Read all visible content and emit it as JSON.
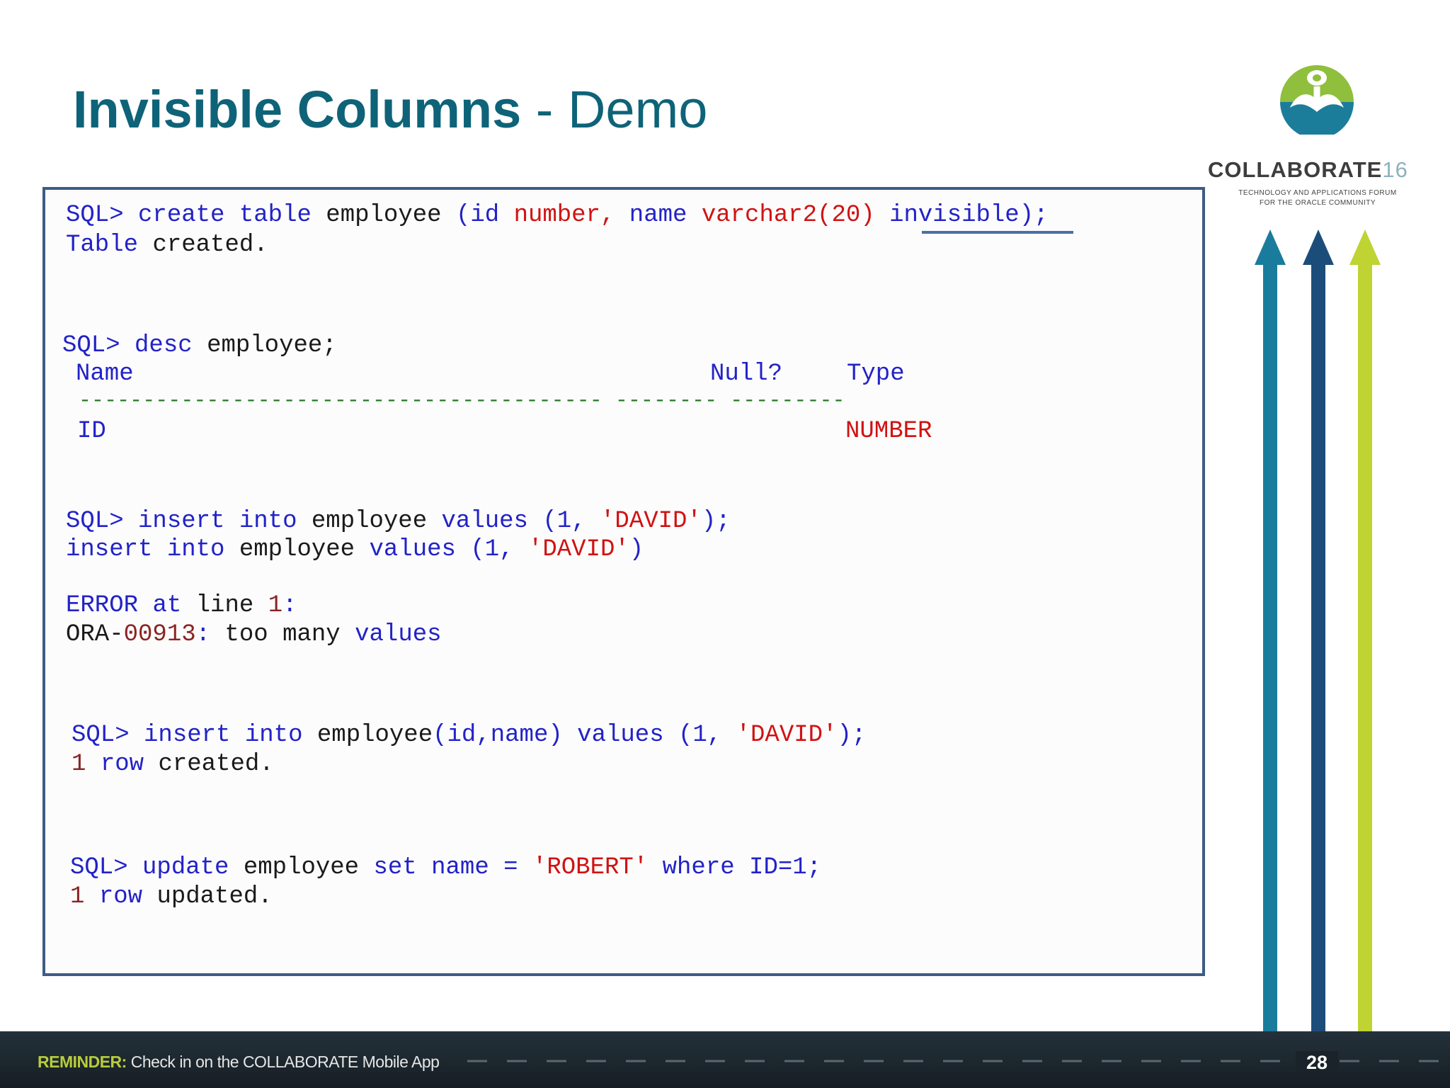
{
  "title": {
    "bold": "Invisible Columns",
    "rest": " - Demo"
  },
  "code": {
    "l1": {
      "p": "SQL>",
      "a": "create",
      "b": "table",
      "c": "employee",
      "d": "(id",
      "e": "number,",
      "f": "name",
      "g": "varchar2(20)",
      "h": "invisible);"
    },
    "l2": {
      "a": "Table",
      "b": "created."
    },
    "l3": {
      "p": "SQL>",
      "a": "desc",
      "b": "employee;"
    },
    "l4": {
      "name": "Name",
      "null": "Null?",
      "type": "Type"
    },
    "l5": {
      "d1": "-----------------------------------------",
      "d2": "--------",
      "d3": "---------"
    },
    "l6": {
      "id": "ID",
      "type": "NUMBER"
    },
    "l7": {
      "p": "SQL>",
      "a": "insert",
      "b": "into",
      "c": "employee",
      "d": "values",
      "e": "(1,",
      "f": "'DAVID'",
      "g": ");"
    },
    "l8": {
      "a": "insert",
      "b": "into",
      "c": "employee",
      "d": "values",
      "e": "(1,",
      "f": "'DAVID'",
      "g": ")"
    },
    "l9": {
      "a": "ERROR",
      "b": "at",
      "c": "line",
      "d": "1",
      "e": ":"
    },
    "l10": {
      "a": "ORA-",
      "b": "00913",
      "c": ":",
      "d": "too",
      "e": "many",
      "f": "values"
    },
    "l11": {
      "p": "SQL>",
      "a": "insert",
      "b": "into",
      "c": "employee",
      "d": "(id,name)",
      "e": "values",
      "f": "(1,",
      "g": "'DAVID'",
      "h": ");"
    },
    "l12": {
      "a": "1",
      "b": "row",
      "c": "created."
    },
    "l13": {
      "p": "SQL>",
      "a": "update",
      "b": "employee",
      "c": "set",
      "d": "name",
      "e": "=",
      "f": "'ROBERT'",
      "g": "where",
      "h": "ID=1;"
    },
    "l14": {
      "a": "1",
      "b": "row",
      "c": "updated."
    }
  },
  "logo": {
    "word": "COLLABORATE",
    "year": "16",
    "tag1": "TECHNOLOGY AND APPLICATIONS FORUM",
    "tag2": "FOR THE ORACLE COMMUNITY"
  },
  "footer": {
    "lead": "REMINDER:",
    "text": " Check in on the COLLABORATE Mobile App",
    "page": "28"
  },
  "colors": {
    "teal": "#0e6378",
    "keyword": "#2222c8",
    "string": "#d11212",
    "arrow_teal": "#1a7c9c",
    "arrow_navy": "#1c4d7a",
    "arrow_green": "#bfd332"
  }
}
